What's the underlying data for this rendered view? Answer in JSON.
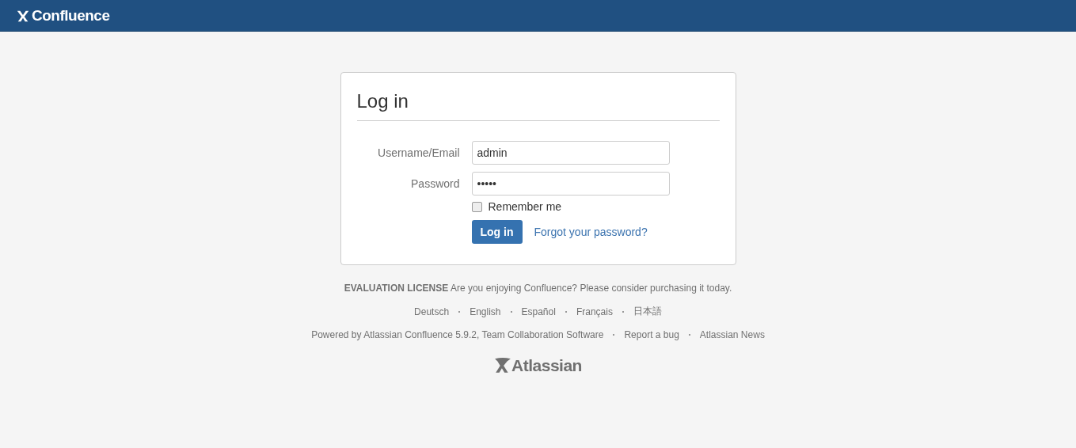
{
  "header": {
    "logo_text": "Confluence"
  },
  "login": {
    "title": "Log in",
    "fields": [
      {
        "label": "Username/Email",
        "value": "admin"
      },
      {
        "label": "Password",
        "value": "•••••"
      }
    ],
    "remember": {
      "label": "Remember me",
      "checked": false
    },
    "submit": "Log in",
    "forgot": "Forgot your password?"
  },
  "footer": {
    "license_bold": "EVALUATION LICENSE",
    "license_text": "Are you enjoying Confluence? Please consider purchasing it today.",
    "languages": [
      "Deutsch",
      "English",
      "Español",
      "Français",
      "日本語"
    ],
    "links": [
      "Powered by Atlassian Confluence 5.9.2, Team Collaboration Software",
      "Report a bug",
      "Atlassian News"
    ],
    "brand": "Atlassian"
  }
}
